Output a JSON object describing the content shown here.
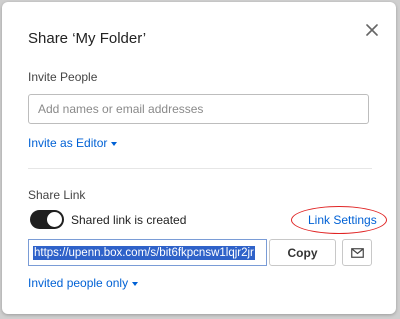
{
  "dialog": {
    "title": "Share ‘My Folder’",
    "close_icon": "close-icon"
  },
  "invite": {
    "section_label": "Invite People",
    "input_placeholder": "Add names or email addresses",
    "input_value": "",
    "role_dropdown_label": "Invite as Editor"
  },
  "share_link": {
    "section_label": "Share Link",
    "toggle_on": true,
    "toggle_label": "Shared link is created",
    "link_settings_label": "Link Settings",
    "url_value": "https://upenn.box.com/s/bit6fkpcnsw1lqjr2jr",
    "copy_label": "Copy",
    "email_icon": "email-icon",
    "access_dropdown_label": "Invited people only"
  },
  "colors": {
    "accent": "#0061d5",
    "annotation_ring": "#e02424",
    "toggle_on": "#1f1f1f",
    "selection": "#2f62c9"
  }
}
